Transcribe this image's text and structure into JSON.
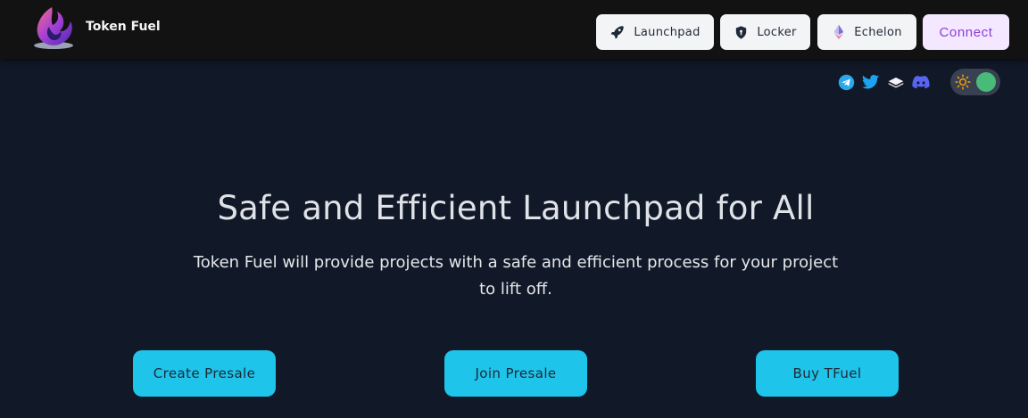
{
  "header": {
    "brand_name": "Token Fuel",
    "nav": {
      "launchpad_label": "Launchpad",
      "locker_label": "Locker",
      "echelon_label": "Echelon",
      "connect_label": "Connect"
    }
  },
  "socials": [
    "telegram-icon",
    "twitter-icon",
    "gitbook-icon",
    "discord-icon"
  ],
  "theme_toggle": {
    "icon": "sun-icon",
    "state": "on"
  },
  "hero": {
    "title": "Safe and Efficient Launchpad for All",
    "subtitle": "Token Fuel will provide projects with a safe and efficient process for your project to lift off."
  },
  "actions": {
    "create_label": "Create Presale",
    "join_label": "Join Presale",
    "buy_label": "Buy TFuel"
  },
  "colors": {
    "background": "#111827",
    "navbar": "#121212",
    "accent": "#1ec4ea",
    "connect_text": "#8b3dd8",
    "toggle_knob": "#48bb78"
  }
}
